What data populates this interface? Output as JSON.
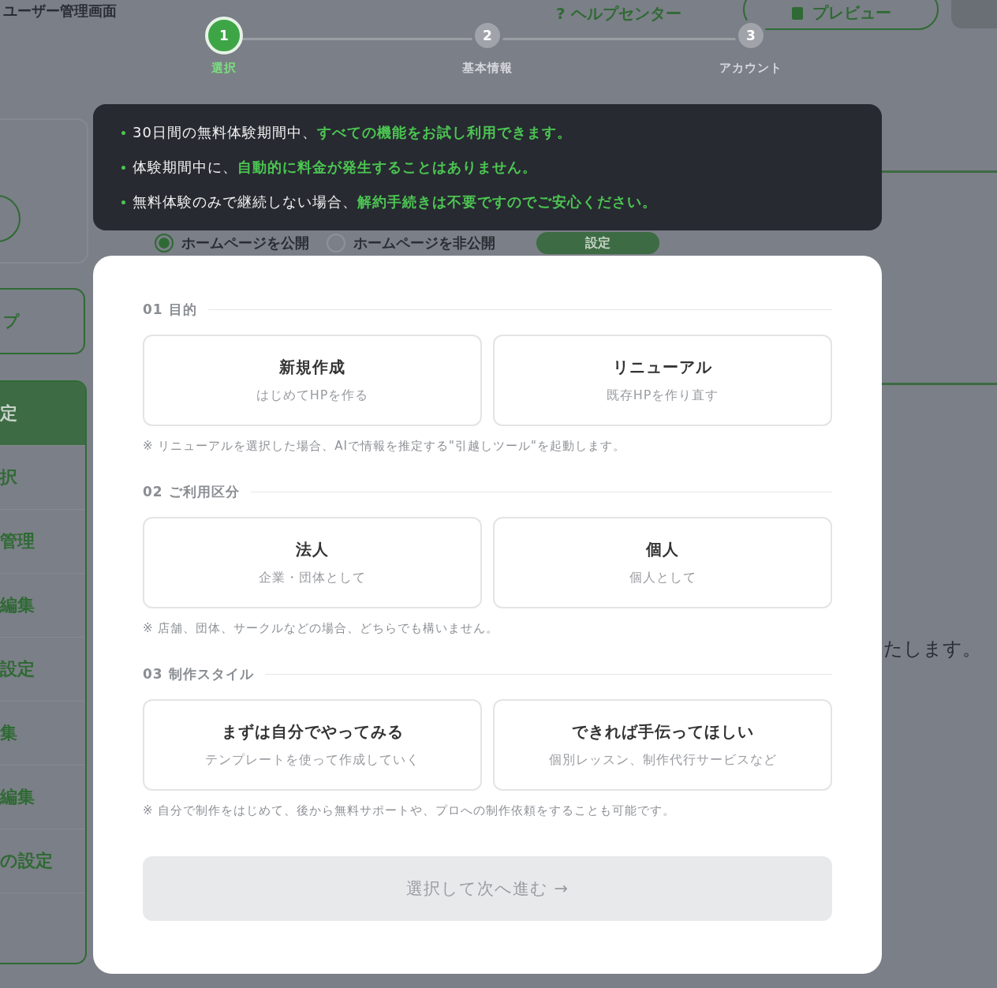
{
  "background": {
    "header": {
      "title": "ユーザー管理画面",
      "help_link": "? ヘルプセンター",
      "preview_button": "プレビュー"
    },
    "sidebar": {
      "button": "プ",
      "menu": [
        {
          "label": "定",
          "selected": true
        },
        {
          "label": "択",
          "selected": false
        },
        {
          "label": "管理",
          "selected": false
        },
        {
          "label": "編集",
          "selected": false
        },
        {
          "label": "設定",
          "selected": false
        },
        {
          "label": "集",
          "selected": false
        },
        {
          "label": "編集",
          "selected": false
        },
        {
          "label": "の設定",
          "selected": false
        }
      ]
    },
    "visibility": {
      "options": [
        {
          "label": "ホームページを公開",
          "selected": true
        },
        {
          "label": "ホームページを非公開",
          "selected": false
        }
      ],
      "button": "設定"
    },
    "notice_fragment": "たします。"
  },
  "stepper": [
    {
      "number": "1",
      "label": "選択",
      "selected": true
    },
    {
      "number": "2",
      "label": "基本情報",
      "selected": false
    },
    {
      "number": "3",
      "label": "アカウント",
      "selected": false
    }
  ],
  "info_banner": [
    "30日間の無料体験期間中、**すべての機能をお試し利用できます。**",
    "体験期間中に、**自動的に料金が発生することはありません。**",
    "無料体験のみで継続しない場合、**解約手続きは不要ですのでご安心ください。**"
  ],
  "sections": [
    {
      "heading": "01 目的",
      "options": [
        {
          "title": "新規作成",
          "subtitle": "はじめてHPを作る",
          "selected": false
        },
        {
          "title": "リニューアル",
          "subtitle": "既存HPを作り直す",
          "selected": false
        }
      ],
      "note": "※ リニューアルを選択した場合、AIで情報を推定する\"引越しツール\"を起動します。"
    },
    {
      "heading": "02 ご利用区分",
      "options": [
        {
          "title": "法人",
          "subtitle": "企業・団体として",
          "selected": false
        },
        {
          "title": "個人",
          "subtitle": "個人として",
          "selected": false
        }
      ],
      "note": "※ 店舗、団体、サークルなどの場合、どちらでも構いません。"
    },
    {
      "heading": "03 制作スタイル",
      "options": [
        {
          "title": "まずは自分でやってみる",
          "subtitle": "テンプレートを使って作成していく",
          "selected": false
        },
        {
          "title": "できれば手伝ってほしい",
          "subtitle": "個別レッスン、制作代行サービスなど",
          "selected": false
        }
      ],
      "note": "※ 自分で制作をはじめて、後から無料サポートや、プロへの制作依頼をすることも可能です。"
    }
  ],
  "next_button": {
    "label": "選択して次へ進む →",
    "disabled": true
  }
}
